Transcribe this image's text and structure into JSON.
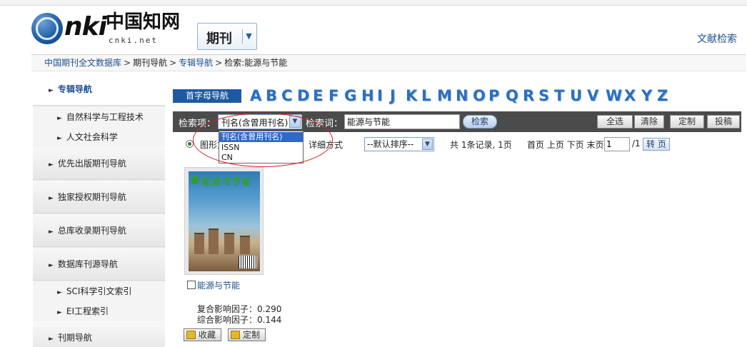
{
  "logo": {
    "brand": "CNKI",
    "cn_name": "中国知网",
    "domain": "cnki.net"
  },
  "qikan_select": {
    "label": "期刊",
    "arrow": "⌄"
  },
  "top_link": "文献检索",
  "breadcrumb": [
    {
      "label": "中国期刊全文数据库",
      "link": true
    },
    {
      "label": "期刊导航",
      "link": true
    },
    {
      "label": "专辑导航",
      "link": true
    },
    {
      "label": "检索:能源与节能",
      "link": false
    }
  ],
  "breadcrumb_sep": ">",
  "sidebar": {
    "items": [
      {
        "label": "专辑导航",
        "type": "head",
        "active": true
      },
      {
        "label": "自然科学与工程技术",
        "type": "sub"
      },
      {
        "label": "人文社会科学",
        "type": "sub"
      },
      {
        "label": "优先出版期刊导航",
        "type": "head"
      },
      {
        "label": "独家授权期刊导航",
        "type": "head"
      },
      {
        "label": "总库收录期刊导航",
        "type": "head"
      },
      {
        "label": "数据库刊源导航",
        "type": "head"
      },
      {
        "label": "SCI科学引文索引",
        "type": "sub"
      },
      {
        "label": "EI工程索引",
        "type": "sub"
      },
      {
        "label": "刊期导航",
        "type": "head"
      }
    ]
  },
  "letter_nav": {
    "label": "首字母导航",
    "letters": [
      "A",
      "B",
      "C",
      "D",
      "E",
      "F",
      "G",
      "H",
      "I",
      "J",
      "K",
      "L",
      "M",
      "N",
      "O",
      "P",
      "Q",
      "R",
      "S",
      "T",
      "U",
      "V",
      "W",
      "X",
      "Y",
      "Z"
    ]
  },
  "search": {
    "field_label": "检索项：",
    "field_value": "刊名(含曾用刊名)",
    "keyword_label": "检索词：",
    "keyword_value": "能源与节能",
    "search_button": "检索",
    "actions": [
      "全选",
      "清除",
      "定制",
      "投稿"
    ],
    "dropdown_options": [
      "刊名(含曾用刊名)",
      "ISSN",
      "CN"
    ]
  },
  "view": {
    "graphic_label": "图形方式",
    "detail_label": "详细方式",
    "sort_value": "--默认排序--",
    "record_count": "共 1条记录, 1页",
    "pager": "首页 上页 下页 末页",
    "page_value": "1",
    "page_total": "/1",
    "go_button": "转 页"
  },
  "journal": {
    "name": "能源与节能",
    "cover_title": "能源与节能",
    "impact_composite": "复合影响因子：0.290",
    "impact_overall": "综合影响因子：0.144",
    "collect_button": "收藏",
    "customize_button": "定制"
  }
}
